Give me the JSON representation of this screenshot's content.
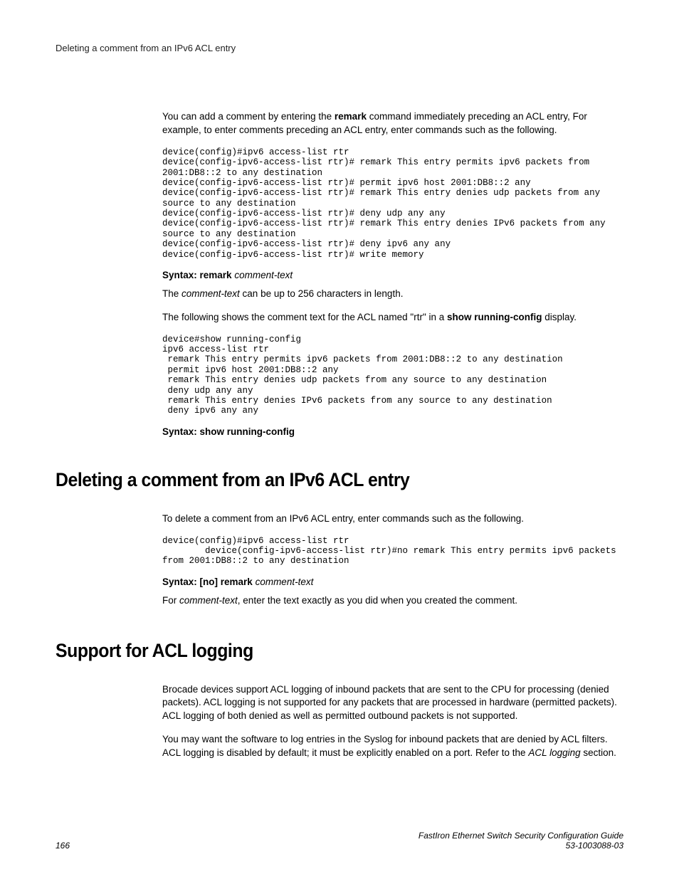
{
  "header": {
    "title": "Deleting a comment from an IPv6 ACL entry"
  },
  "intro": {
    "p1_a": "You can add a comment by entering the ",
    "p1_bold": "remark",
    "p1_b": " command immediately preceding an ACL entry, For example, to enter comments preceding an ACL entry, enter commands such as the following."
  },
  "code1": "device(config)#ipv6 access-list rtr\ndevice(config-ipv6-access-list rtr)# remark This entry permits ipv6 packets from 2001:DB8::2 to any destination\ndevice(config-ipv6-access-list rtr)# permit ipv6 host 2001:DB8::2 any\ndevice(config-ipv6-access-list rtr)# remark This entry denies udp packets from any source to any destination\ndevice(config-ipv6-access-list rtr)# deny udp any any\ndevice(config-ipv6-access-list rtr)# remark This entry denies IPv6 packets from any source to any destination\ndevice(config-ipv6-access-list rtr)# deny ipv6 any any\ndevice(config-ipv6-access-list rtr)# write memory",
  "syntax1": {
    "label": "Syntax: remark",
    "arg": "comment-text"
  },
  "p2_a": "The ",
  "p2_italic": "comment-text",
  "p2_b": " can be up to 256 characters in length.",
  "p3_a": "The following shows the comment text for the ACL named \"rtr\" in a ",
  "p3_bold": "show running-config",
  "p3_b": " display.",
  "code2": "device#show running-config \nipv6 access-list rtr\n remark This entry permits ipv6 packets from 2001:DB8::2 to any destination\n permit ipv6 host 2001:DB8::2 any\n remark This entry denies udp packets from any source to any destination\n deny udp any any\n remark This entry denies IPv6 packets from any source to any destination\n deny ipv6 any any",
  "syntax2": {
    "label": "Syntax: show running-config"
  },
  "section1": {
    "heading": "Deleting a comment from an IPv6 ACL entry",
    "p1": "To delete a comment from an IPv6 ACL entry, enter commands such as the following.",
    "code": "device(config)#ipv6 access-list rtr\n        device(config-ipv6-access-list rtr)#no remark This entry permits ipv6 packets from 2001:DB8::2 to any destination",
    "syntax_label": "Syntax: [no] remark",
    "syntax_arg": "comment-text",
    "p2_a": "For ",
    "p2_italic": "comment-text",
    "p2_b": ", enter the text exactly as you did when you created the comment."
  },
  "section2": {
    "heading": "Support for ACL logging",
    "p1": "Brocade devices support ACL logging of inbound packets that are sent to the CPU for processing (denied packets). ACL logging is not supported for any packets that are processed in hardware (permitted packets). ACL logging of both denied as well as permitted outbound packets is not supported.",
    "p2_a": "You may want the software to log entries in the Syslog for inbound packets that are denied by ACL filters. ACL logging is disabled by default; it must be explicitly enabled on a port. Refer to the ",
    "p2_italic": "ACL logging",
    "p2_b": " section."
  },
  "footer": {
    "page": "166",
    "title": "FastIron Ethernet Switch Security Configuration Guide",
    "docnum": "53-1003088-03"
  }
}
